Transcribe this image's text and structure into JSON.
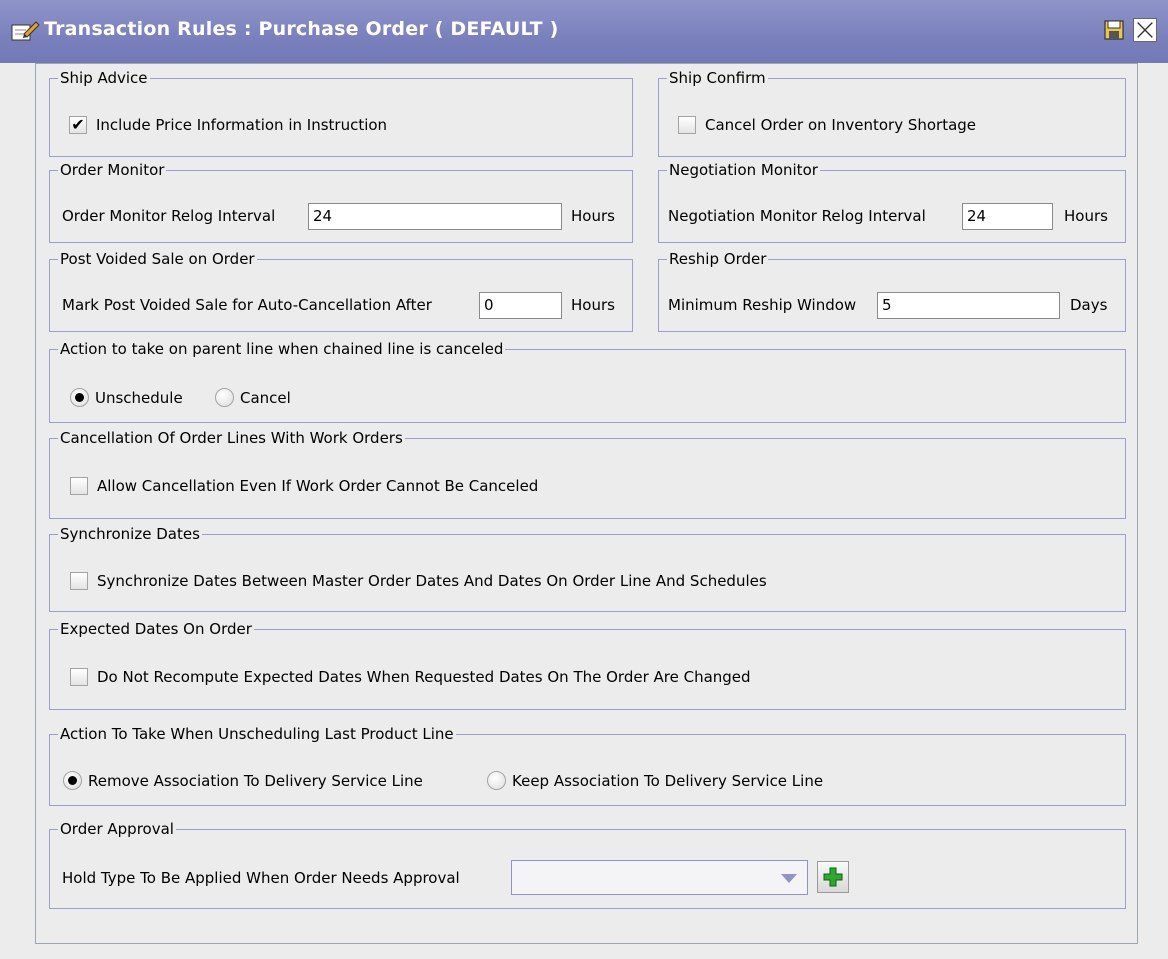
{
  "window": {
    "title": "Transaction Rules : Purchase Order ( DEFAULT )",
    "icons": [
      "edit-document-icon",
      "save-icon",
      "close-icon"
    ]
  },
  "ship_advice": {
    "legend": "Ship Advice",
    "include_price": {
      "label": "Include Price Information in Instruction",
      "checked": true
    }
  },
  "ship_confirm": {
    "legend": "Ship Confirm",
    "cancel_on_shortage": {
      "label": "Cancel Order on Inventory Shortage",
      "checked": false
    }
  },
  "order_monitor": {
    "legend": "Order Monitor",
    "label": "Order Monitor Relog Interval",
    "value": "24",
    "unit": "Hours"
  },
  "negotiation_monitor": {
    "legend": "Negotiation Monitor",
    "label": "Negotiation Monitor Relog Interval",
    "value": "24",
    "unit": "Hours"
  },
  "post_voided": {
    "legend": "Post Voided Sale on Order",
    "label": "Mark Post Voided Sale for Auto-Cancellation After",
    "value": "0",
    "unit": "Hours"
  },
  "reship": {
    "legend": "Reship Order",
    "label": "Minimum Reship Window",
    "value": "5",
    "unit": "Days"
  },
  "chained_line": {
    "legend": "Action to take on parent line when chained line is canceled",
    "options": [
      {
        "label": "Unschedule",
        "selected": true
      },
      {
        "label": "Cancel",
        "selected": false
      }
    ]
  },
  "work_orders": {
    "legend": "Cancellation Of Order Lines With Work Orders",
    "allow_cancel": {
      "label": "Allow Cancellation Even If Work Order Cannot Be Canceled",
      "checked": false
    }
  },
  "sync_dates": {
    "legend": "Synchronize Dates",
    "sync": {
      "label": "Synchronize Dates Between Master Order Dates And Dates On Order Line And Schedules",
      "checked": false
    }
  },
  "expected_dates": {
    "legend": "Expected Dates On Order",
    "no_recompute": {
      "label": "Do Not Recompute Expected Dates When Requested Dates On The Order Are Changed",
      "checked": false
    }
  },
  "unscheduling": {
    "legend": "Action To Take When Unscheduling Last Product Line",
    "options": [
      {
        "label": "Remove Association To Delivery Service Line",
        "selected": true
      },
      {
        "label": "Keep Association To Delivery Service Line",
        "selected": false
      }
    ]
  },
  "order_approval": {
    "legend": "Order Approval",
    "label": "Hold Type To Be Applied When Order Needs Approval",
    "selected_value": ""
  },
  "colors": {
    "titlebar": "#7a80bc",
    "group_border": "#9aa0c9",
    "add_icon": "#2fa82f"
  }
}
